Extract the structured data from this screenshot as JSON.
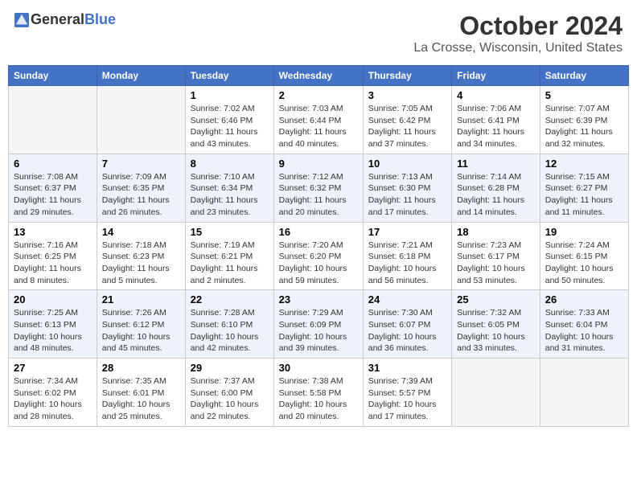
{
  "header": {
    "logo_general": "General",
    "logo_blue": "Blue",
    "month_title": "October 2024",
    "location": "La Crosse, Wisconsin, United States"
  },
  "weekdays": [
    "Sunday",
    "Monday",
    "Tuesday",
    "Wednesday",
    "Thursday",
    "Friday",
    "Saturday"
  ],
  "rows": [
    [
      {
        "day": "",
        "info": ""
      },
      {
        "day": "",
        "info": ""
      },
      {
        "day": "1",
        "info": "Sunrise: 7:02 AM\nSunset: 6:46 PM\nDaylight: 11 hours and 43 minutes."
      },
      {
        "day": "2",
        "info": "Sunrise: 7:03 AM\nSunset: 6:44 PM\nDaylight: 11 hours and 40 minutes."
      },
      {
        "day": "3",
        "info": "Sunrise: 7:05 AM\nSunset: 6:42 PM\nDaylight: 11 hours and 37 minutes."
      },
      {
        "day": "4",
        "info": "Sunrise: 7:06 AM\nSunset: 6:41 PM\nDaylight: 11 hours and 34 minutes."
      },
      {
        "day": "5",
        "info": "Sunrise: 7:07 AM\nSunset: 6:39 PM\nDaylight: 11 hours and 32 minutes."
      }
    ],
    [
      {
        "day": "6",
        "info": "Sunrise: 7:08 AM\nSunset: 6:37 PM\nDaylight: 11 hours and 29 minutes."
      },
      {
        "day": "7",
        "info": "Sunrise: 7:09 AM\nSunset: 6:35 PM\nDaylight: 11 hours and 26 minutes."
      },
      {
        "day": "8",
        "info": "Sunrise: 7:10 AM\nSunset: 6:34 PM\nDaylight: 11 hours and 23 minutes."
      },
      {
        "day": "9",
        "info": "Sunrise: 7:12 AM\nSunset: 6:32 PM\nDaylight: 11 hours and 20 minutes."
      },
      {
        "day": "10",
        "info": "Sunrise: 7:13 AM\nSunset: 6:30 PM\nDaylight: 11 hours and 17 minutes."
      },
      {
        "day": "11",
        "info": "Sunrise: 7:14 AM\nSunset: 6:28 PM\nDaylight: 11 hours and 14 minutes."
      },
      {
        "day": "12",
        "info": "Sunrise: 7:15 AM\nSunset: 6:27 PM\nDaylight: 11 hours and 11 minutes."
      }
    ],
    [
      {
        "day": "13",
        "info": "Sunrise: 7:16 AM\nSunset: 6:25 PM\nDaylight: 11 hours and 8 minutes."
      },
      {
        "day": "14",
        "info": "Sunrise: 7:18 AM\nSunset: 6:23 PM\nDaylight: 11 hours and 5 minutes."
      },
      {
        "day": "15",
        "info": "Sunrise: 7:19 AM\nSunset: 6:21 PM\nDaylight: 11 hours and 2 minutes."
      },
      {
        "day": "16",
        "info": "Sunrise: 7:20 AM\nSunset: 6:20 PM\nDaylight: 10 hours and 59 minutes."
      },
      {
        "day": "17",
        "info": "Sunrise: 7:21 AM\nSunset: 6:18 PM\nDaylight: 10 hours and 56 minutes."
      },
      {
        "day": "18",
        "info": "Sunrise: 7:23 AM\nSunset: 6:17 PM\nDaylight: 10 hours and 53 minutes."
      },
      {
        "day": "19",
        "info": "Sunrise: 7:24 AM\nSunset: 6:15 PM\nDaylight: 10 hours and 50 minutes."
      }
    ],
    [
      {
        "day": "20",
        "info": "Sunrise: 7:25 AM\nSunset: 6:13 PM\nDaylight: 10 hours and 48 minutes."
      },
      {
        "day": "21",
        "info": "Sunrise: 7:26 AM\nSunset: 6:12 PM\nDaylight: 10 hours and 45 minutes."
      },
      {
        "day": "22",
        "info": "Sunrise: 7:28 AM\nSunset: 6:10 PM\nDaylight: 10 hours and 42 minutes."
      },
      {
        "day": "23",
        "info": "Sunrise: 7:29 AM\nSunset: 6:09 PM\nDaylight: 10 hours and 39 minutes."
      },
      {
        "day": "24",
        "info": "Sunrise: 7:30 AM\nSunset: 6:07 PM\nDaylight: 10 hours and 36 minutes."
      },
      {
        "day": "25",
        "info": "Sunrise: 7:32 AM\nSunset: 6:05 PM\nDaylight: 10 hours and 33 minutes."
      },
      {
        "day": "26",
        "info": "Sunrise: 7:33 AM\nSunset: 6:04 PM\nDaylight: 10 hours and 31 minutes."
      }
    ],
    [
      {
        "day": "27",
        "info": "Sunrise: 7:34 AM\nSunset: 6:02 PM\nDaylight: 10 hours and 28 minutes."
      },
      {
        "day": "28",
        "info": "Sunrise: 7:35 AM\nSunset: 6:01 PM\nDaylight: 10 hours and 25 minutes."
      },
      {
        "day": "29",
        "info": "Sunrise: 7:37 AM\nSunset: 6:00 PM\nDaylight: 10 hours and 22 minutes."
      },
      {
        "day": "30",
        "info": "Sunrise: 7:38 AM\nSunset: 5:58 PM\nDaylight: 10 hours and 20 minutes."
      },
      {
        "day": "31",
        "info": "Sunrise: 7:39 AM\nSunset: 5:57 PM\nDaylight: 10 hours and 17 minutes."
      },
      {
        "day": "",
        "info": ""
      },
      {
        "day": "",
        "info": ""
      }
    ]
  ]
}
